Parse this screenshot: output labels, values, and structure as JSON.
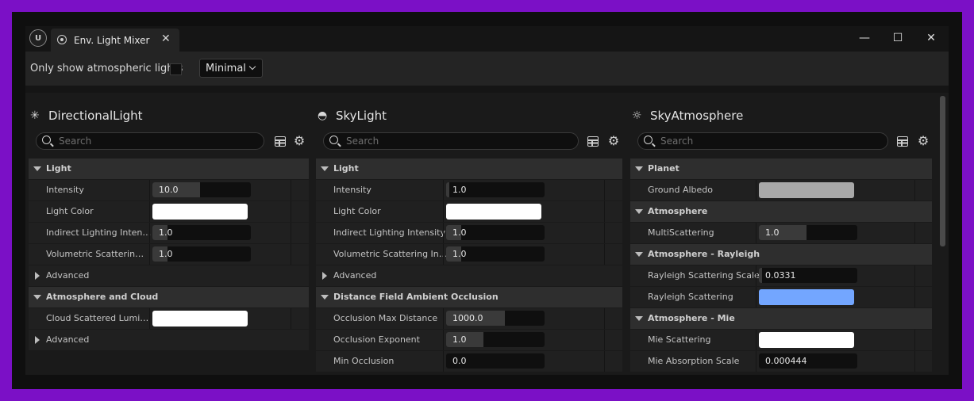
{
  "window": {
    "tab_title": "Env. Light Mixer",
    "tab_close": "✕",
    "minimize": "—",
    "maximize": "☐",
    "close": "✕"
  },
  "toolbar": {
    "checkbox_label": "Only show atmospheric lights",
    "checkbox_checked": false,
    "dropdown_value": "Minimal"
  },
  "search_placeholder": "Search",
  "panels": [
    {
      "title": "DirectionalLight",
      "icon": "directional-light-icon",
      "rows": [
        {
          "kind": "category",
          "label": "Light"
        },
        {
          "kind": "number",
          "label": "Intensity",
          "value": "10.0",
          "fill": 0.48
        },
        {
          "kind": "color",
          "label": "Light Color",
          "color": "#ffffff"
        },
        {
          "kind": "number",
          "label": "Indirect Lighting Inten…",
          "value": "1.0",
          "fill": 0.15
        },
        {
          "kind": "number",
          "label": "Volumetric Scatterin…",
          "value": "1.0",
          "fill": 0.15
        },
        {
          "kind": "sub",
          "label": "Advanced"
        },
        {
          "kind": "category",
          "label": "Atmosphere and Cloud"
        },
        {
          "kind": "color",
          "label": "Cloud Scattered Lumi…",
          "color": "#ffffff"
        },
        {
          "kind": "sub",
          "label": "Advanced"
        }
      ]
    },
    {
      "title": "SkyLight",
      "icon": "sky-light-icon",
      "rows": [
        {
          "kind": "category",
          "label": "Light"
        },
        {
          "kind": "number",
          "label": "Intensity",
          "value": "1.0",
          "fill": 0.02
        },
        {
          "kind": "color",
          "label": "Light Color",
          "color": "#ffffff"
        },
        {
          "kind": "number",
          "label": "Indirect Lighting Intensity",
          "value": "1.0",
          "fill": 0.15
        },
        {
          "kind": "number",
          "label": "Volumetric Scattering In…",
          "value": "1.0",
          "fill": 0.15
        },
        {
          "kind": "sub",
          "label": "Advanced"
        },
        {
          "kind": "category",
          "label": "Distance Field Ambient Occlusion"
        },
        {
          "kind": "number",
          "label": "Occlusion Max Distance",
          "value": "1000.0",
          "fill": 0.6
        },
        {
          "kind": "number",
          "label": "Occlusion Exponent",
          "value": "1.0",
          "fill": 0.38
        },
        {
          "kind": "number",
          "label": "Min Occlusion",
          "value": "0.0",
          "fill": 0
        }
      ]
    },
    {
      "title": "SkyAtmosphere",
      "icon": "sky-atmosphere-icon",
      "rows": [
        {
          "kind": "category",
          "label": "Planet"
        },
        {
          "kind": "color",
          "label": "Ground Albedo",
          "color": "#a9a9a9"
        },
        {
          "kind": "category",
          "label": "Atmosphere"
        },
        {
          "kind": "number",
          "label": "MultiScattering",
          "value": "1.0",
          "fill": 0.48
        },
        {
          "kind": "category",
          "label": "Atmosphere - Rayleigh"
        },
        {
          "kind": "number",
          "label": "Rayleigh Scattering Scale",
          "value": "0.0331",
          "fill": 0.02
        },
        {
          "kind": "color",
          "label": "Rayleigh Scattering",
          "color": "#73a6ff"
        },
        {
          "kind": "category",
          "label": "Atmosphere - Mie"
        },
        {
          "kind": "color",
          "label": "Mie Scattering",
          "color": "#ffffff"
        },
        {
          "kind": "number",
          "label": "Mie Absorption Scale",
          "value": "0.000444",
          "fill": 0
        }
      ]
    }
  ]
}
